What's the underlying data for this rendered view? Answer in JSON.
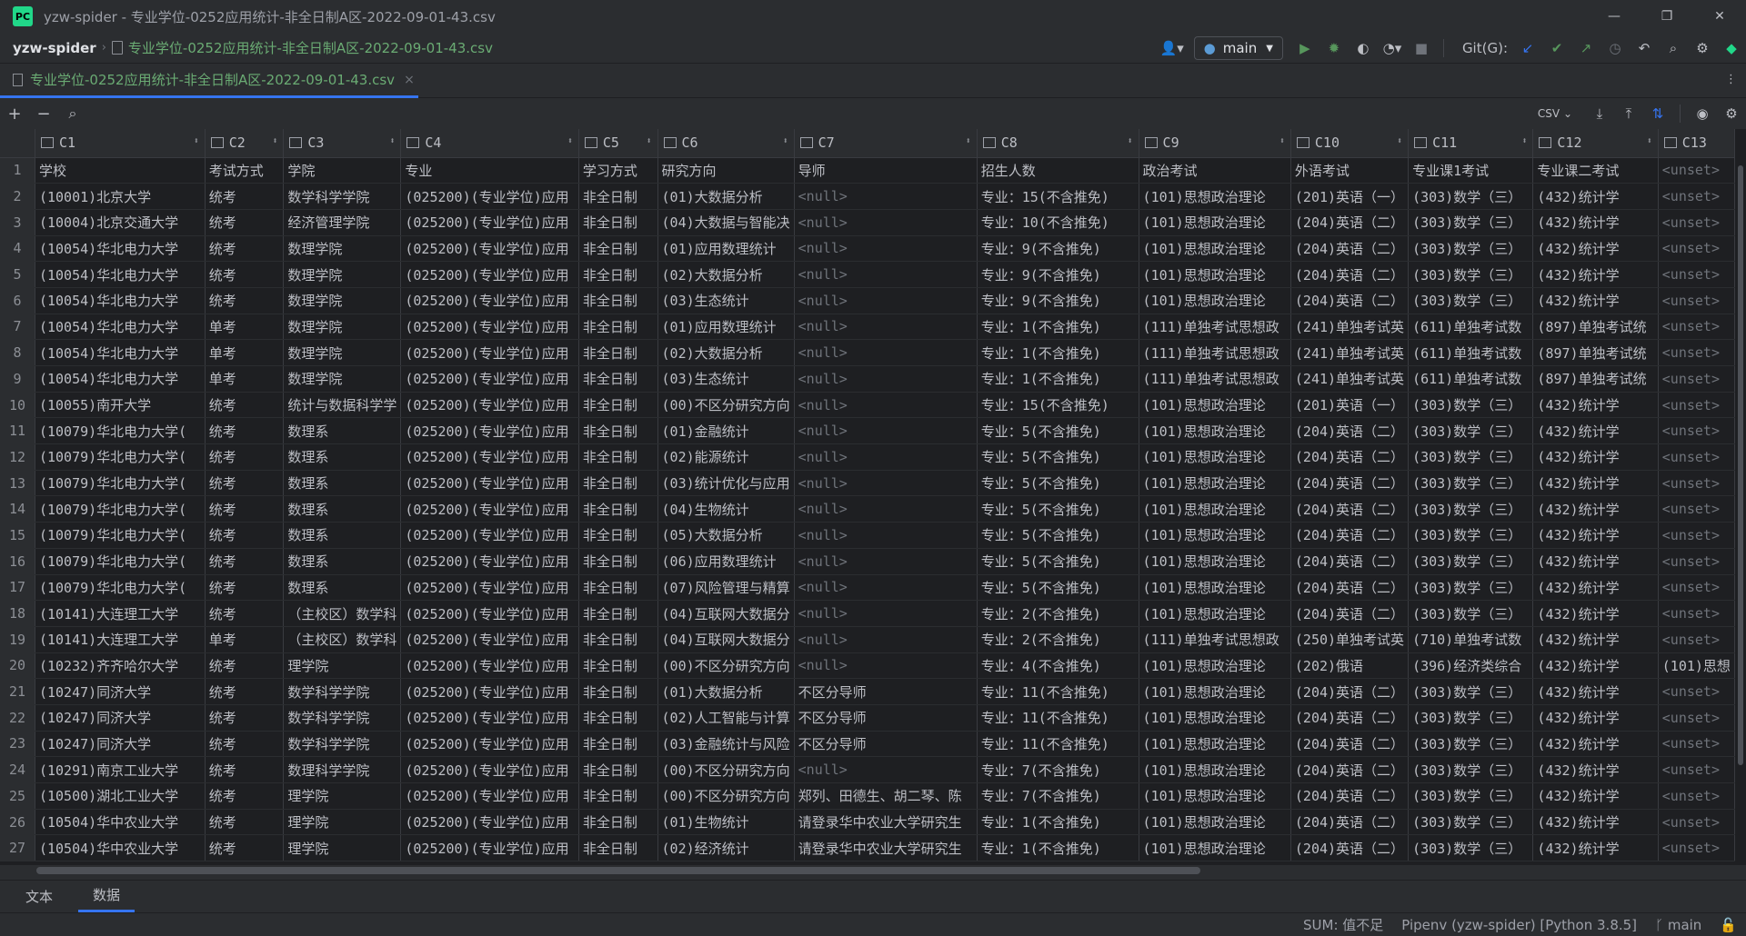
{
  "window": {
    "title": "yzw-spider - 专业学位-0252应用统计-非全日制A区-2022-09-01-43.csv",
    "logo": "PC",
    "minimize": "—",
    "restore": "❐",
    "close": "✕"
  },
  "breadcrumb": {
    "project": "yzw-spider",
    "separator": "›",
    "file": "专业学位-0252应用统计-非全日制A区-2022-09-01-43.csv"
  },
  "toolbar": {
    "branch": "main",
    "git_label": "Git(G):"
  },
  "editor_tab": {
    "label": "专业学位-0252应用统计-非全日制A区-2022-09-01-43.csv",
    "close": "×"
  },
  "grid_toolbar": {
    "add": "+",
    "remove": "−",
    "format": "CSV ⌄"
  },
  "columns": [
    "C1",
    "C2",
    "C3",
    "C4",
    "C5",
    "C6",
    "C7",
    "C8",
    "C9",
    "C10",
    "C11",
    "C12",
    "C13"
  ],
  "rows": [
    [
      "1",
      "学校",
      "考试方式",
      "学院",
      "专业",
      "学习方式",
      "研究方向",
      "导师",
      "招生人数",
      "政治考试",
      "外语考试",
      "专业课1考试",
      "专业课二考试",
      "<unset>"
    ],
    [
      "2",
      "(10001)北京大学",
      "统考",
      "数学科学学院",
      "(025200)(专业学位)应用",
      "非全日制",
      "(01)大数据分析",
      "<null>",
      "专业：15(不含推免)",
      "(101)思想政治理论",
      "(201)英语（一）",
      "(303)数学（三）",
      "(432)统计学",
      "<unset>"
    ],
    [
      "3",
      "(10004)北京交通大学",
      "统考",
      "经济管理学院",
      "(025200)(专业学位)应用",
      "非全日制",
      "(04)大数据与智能决",
      "<null>",
      "专业：10(不含推免)",
      "(101)思想政治理论",
      "(204)英语（二）",
      "(303)数学（三）",
      "(432)统计学",
      "<unset>"
    ],
    [
      "4",
      "(10054)华北电力大学",
      "统考",
      "数理学院",
      "(025200)(专业学位)应用",
      "非全日制",
      "(01)应用数理统计",
      "<null>",
      "专业：9(不含推免)",
      "(101)思想政治理论",
      "(204)英语（二）",
      "(303)数学（三）",
      "(432)统计学",
      "<unset>"
    ],
    [
      "5",
      "(10054)华北电力大学",
      "统考",
      "数理学院",
      "(025200)(专业学位)应用",
      "非全日制",
      "(02)大数据分析",
      "<null>",
      "专业：9(不含推免)",
      "(101)思想政治理论",
      "(204)英语（二）",
      "(303)数学（三）",
      "(432)统计学",
      "<unset>"
    ],
    [
      "6",
      "(10054)华北电力大学",
      "统考",
      "数理学院",
      "(025200)(专业学位)应用",
      "非全日制",
      "(03)生态统计",
      "<null>",
      "专业：9(不含推免)",
      "(101)思想政治理论",
      "(204)英语（二）",
      "(303)数学（三）",
      "(432)统计学",
      "<unset>"
    ],
    [
      "7",
      "(10054)华北电力大学",
      "单考",
      "数理学院",
      "(025200)(专业学位)应用",
      "非全日制",
      "(01)应用数理统计",
      "<null>",
      "专业：1(不含推免)",
      "(111)单独考试思想政",
      "(241)单独考试英",
      "(611)单独考试数",
      "(897)单独考试统",
      "<unset>"
    ],
    [
      "8",
      "(10054)华北电力大学",
      "单考",
      "数理学院",
      "(025200)(专业学位)应用",
      "非全日制",
      "(02)大数据分析",
      "<null>",
      "专业：1(不含推免)",
      "(111)单独考试思想政",
      "(241)单独考试英",
      "(611)单独考试数",
      "(897)单独考试统",
      "<unset>"
    ],
    [
      "9",
      "(10054)华北电力大学",
      "单考",
      "数理学院",
      "(025200)(专业学位)应用",
      "非全日制",
      "(03)生态统计",
      "<null>",
      "专业：1(不含推免)",
      "(111)单独考试思想政",
      "(241)单独考试英",
      "(611)单独考试数",
      "(897)单独考试统",
      "<unset>"
    ],
    [
      "10",
      "(10055)南开大学",
      "统考",
      "统计与数据科学学",
      "(025200)(专业学位)应用",
      "非全日制",
      "(00)不区分研究方向",
      "<null>",
      "专业：15(不含推免)",
      "(101)思想政治理论",
      "(201)英语（一）",
      "(303)数学（三）",
      "(432)统计学",
      "<unset>"
    ],
    [
      "11",
      "(10079)华北电力大学(",
      "统考",
      "数理系",
      "(025200)(专业学位)应用",
      "非全日制",
      "(01)金融统计",
      "<null>",
      "专业：5(不含推免)",
      "(101)思想政治理论",
      "(204)英语（二）",
      "(303)数学（三）",
      "(432)统计学",
      "<unset>"
    ],
    [
      "12",
      "(10079)华北电力大学(",
      "统考",
      "数理系",
      "(025200)(专业学位)应用",
      "非全日制",
      "(02)能源统计",
      "<null>",
      "专业：5(不含推免)",
      "(101)思想政治理论",
      "(204)英语（二）",
      "(303)数学（三）",
      "(432)统计学",
      "<unset>"
    ],
    [
      "13",
      "(10079)华北电力大学(",
      "统考",
      "数理系",
      "(025200)(专业学位)应用",
      "非全日制",
      "(03)统计优化与应用",
      "<null>",
      "专业：5(不含推免)",
      "(101)思想政治理论",
      "(204)英语（二）",
      "(303)数学（三）",
      "(432)统计学",
      "<unset>"
    ],
    [
      "14",
      "(10079)华北电力大学(",
      "统考",
      "数理系",
      "(025200)(专业学位)应用",
      "非全日制",
      "(04)生物统计",
      "<null>",
      "专业：5(不含推免)",
      "(101)思想政治理论",
      "(204)英语（二）",
      "(303)数学（三）",
      "(432)统计学",
      "<unset>"
    ],
    [
      "15",
      "(10079)华北电力大学(",
      "统考",
      "数理系",
      "(025200)(专业学位)应用",
      "非全日制",
      "(05)大数据分析",
      "<null>",
      "专业：5(不含推免)",
      "(101)思想政治理论",
      "(204)英语（二）",
      "(303)数学（三）",
      "(432)统计学",
      "<unset>"
    ],
    [
      "16",
      "(10079)华北电力大学(",
      "统考",
      "数理系",
      "(025200)(专业学位)应用",
      "非全日制",
      "(06)应用数理统计",
      "<null>",
      "专业：5(不含推免)",
      "(101)思想政治理论",
      "(204)英语（二）",
      "(303)数学（三）",
      "(432)统计学",
      "<unset>"
    ],
    [
      "17",
      "(10079)华北电力大学(",
      "统考",
      "数理系",
      "(025200)(专业学位)应用",
      "非全日制",
      "(07)风险管理与精算",
      "<null>",
      "专业：5(不含推免)",
      "(101)思想政治理论",
      "(204)英语（二）",
      "(303)数学（三）",
      "(432)统计学",
      "<unset>"
    ],
    [
      "18",
      "(10141)大连理工大学",
      "统考",
      "（主校区）数学科",
      "(025200)(专业学位)应用",
      "非全日制",
      "(04)互联网大数据分",
      "<null>",
      "专业：2(不含推免)",
      "(101)思想政治理论",
      "(204)英语（二）",
      "(303)数学（三）",
      "(432)统计学",
      "<unset>"
    ],
    [
      "19",
      "(10141)大连理工大学",
      "单考",
      "（主校区）数学科",
      "(025200)(专业学位)应用",
      "非全日制",
      "(04)互联网大数据分",
      "<null>",
      "专业：2(不含推免)",
      "(111)单独考试思想政",
      "(250)单独考试英",
      "(710)单独考试数",
      "(432)统计学",
      "<unset>"
    ],
    [
      "20",
      "(10232)齐齐哈尔大学",
      "统考",
      "理学院",
      "(025200)(专业学位)应用",
      "非全日制",
      "(00)不区分研究方向",
      "<null>",
      "专业：4(不含推免)",
      "(101)思想政治理论",
      "(202)俄语",
      "(396)经济类综合",
      "(432)统计学",
      "(101)思想"
    ],
    [
      "21",
      "(10247)同济大学",
      "统考",
      "数学科学学院",
      "(025200)(专业学位)应用",
      "非全日制",
      "(01)大数据分析",
      "不区分导师",
      "专业：11(不含推免)",
      "(101)思想政治理论",
      "(204)英语（二）",
      "(303)数学（三）",
      "(432)统计学",
      "<unset>"
    ],
    [
      "22",
      "(10247)同济大学",
      "统考",
      "数学科学学院",
      "(025200)(专业学位)应用",
      "非全日制",
      "(02)人工智能与计算",
      "不区分导师",
      "专业：11(不含推免)",
      "(101)思想政治理论",
      "(204)英语（二）",
      "(303)数学（三）",
      "(432)统计学",
      "<unset>"
    ],
    [
      "23",
      "(10247)同济大学",
      "统考",
      "数学科学学院",
      "(025200)(专业学位)应用",
      "非全日制",
      "(03)金融统计与风险",
      "不区分导师",
      "专业：11(不含推免)",
      "(101)思想政治理论",
      "(204)英语（二）",
      "(303)数学（三）",
      "(432)统计学",
      "<unset>"
    ],
    [
      "24",
      "(10291)南京工业大学",
      "统考",
      "数理科学学院",
      "(025200)(专业学位)应用",
      "非全日制",
      "(00)不区分研究方向",
      "<null>",
      "专业：7(不含推免)",
      "(101)思想政治理论",
      "(204)英语（二）",
      "(303)数学（三）",
      "(432)统计学",
      "<unset>"
    ],
    [
      "25",
      "(10500)湖北工业大学",
      "统考",
      "理学院",
      "(025200)(专业学位)应用",
      "非全日制",
      "(00)不区分研究方向",
      "郑列、田德生、胡二琴、陈",
      "专业：7(不含推免)",
      "(101)思想政治理论",
      "(204)英语（二）",
      "(303)数学（三）",
      "(432)统计学",
      "<unset>"
    ],
    [
      "26",
      "(10504)华中农业大学",
      "统考",
      "理学院",
      "(025200)(专业学位)应用",
      "非全日制",
      "(01)生物统计",
      "请登录华中农业大学研究生",
      "专业：1(不含推免)",
      "(101)思想政治理论",
      "(204)英语（二）",
      "(303)数学（三）",
      "(432)统计学",
      "<unset>"
    ],
    [
      "27",
      "(10504)华中农业大学",
      "统考",
      "理学院",
      "(025200)(专业学位)应用",
      "非全日制",
      "(02)经济统计",
      "请登录华中农业大学研究生",
      "专业：1(不含推免)",
      "(101)思想政治理论",
      "(204)英语（二）",
      "(303)数学（三）",
      "(432)统计学",
      "<unset>"
    ]
  ],
  "bottom_tabs": {
    "text": "文本",
    "data": "数据"
  },
  "status": {
    "sum": "SUM: 值不足",
    "interpreter": "Pipenv (yzw-spider) [Python 3.8.5]",
    "branch": "main"
  }
}
